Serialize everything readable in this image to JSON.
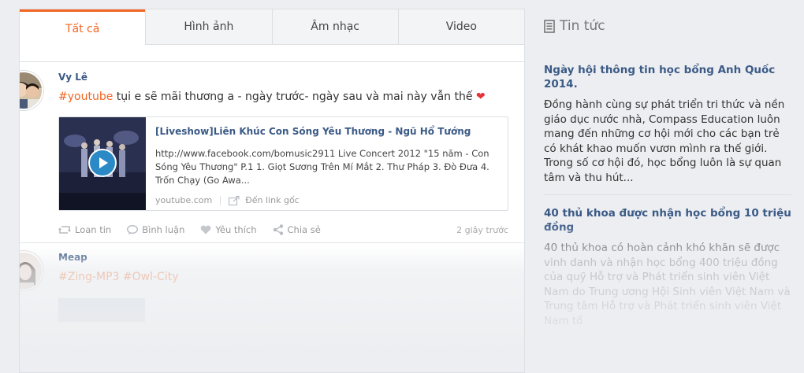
{
  "tabs": [
    {
      "label": "Tất cả",
      "active": true
    },
    {
      "label": "Hình ảnh",
      "active": false
    },
    {
      "label": "Âm nhạc",
      "active": false
    },
    {
      "label": "Video",
      "active": false
    }
  ],
  "posts": [
    {
      "author": "Vy Lê",
      "hashtag": "#youtube",
      "text": " tụi e sẽ mãi thương a - ngày trước- ngày sau và mai này vẫn thế ",
      "emoji": "heart-icon",
      "embed": {
        "title": "[Liveshow]Liên Khúc Con Sóng Yêu Thương - Ngũ Hổ Tướng",
        "description": "http://www.facebook.com/bomusic2911 Live Concert 2012 \"15 năm - Con Sóng Yêu Thương\" P.1 1. Giọt Sương Trên Mí Mắt 2. Thư Pháp 3. Đò Đưa 4. Trốn Chạy (Go Awa...",
        "domain": "youtube.com",
        "source_link": "Đến link gốc"
      },
      "actions": {
        "share": "Loan tin",
        "comment": "Bình luận",
        "like": "Yêu thích",
        "forward": "Chia sẻ"
      },
      "timestamp": "2 giây trước"
    },
    {
      "author": "Meap",
      "hashtags": "#Zing-MP3 #Owl-City"
    }
  ],
  "news": {
    "header": "Tin tức",
    "items": [
      {
        "headline": "Ngày hội thông tin học bổng Anh Quốc 2014.",
        "summary": "Đồng hành cùng sự phát triển tri thức và nền giáo dục nước nhà, Compass Education luôn mang đến những cơ hội mới cho các bạn trẻ có khát khao muốn vươn mình ra thế giới. Trong số cơ hội đó, học bổng luôn là sự quan tâm và thu hút..."
      },
      {
        "headline": "40 thủ khoa được nhận học bổng 10 triệu đồng",
        "summary": "40 thủ khoa có hoàn cảnh khó khăn sẽ được vinh danh và nhận học bổng 400 triệu đồng của quỹ Hỗ trợ và Phát triển sinh viên Việt Nam do Trung ương Hội Sinh viên Việt Nam và Trung tâm Hỗ trợ và Phát triển sinh viên Việt Nam tổ"
      }
    ]
  },
  "colors": {
    "accent": "#f26522",
    "link": "#3b5a86",
    "background": "#eceef1",
    "play": "#2b8ac6"
  }
}
